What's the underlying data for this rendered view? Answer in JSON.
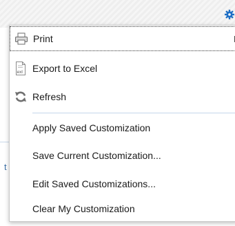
{
  "menu": {
    "items": [
      {
        "label": "Print",
        "icon": "printer-icon",
        "has_submenu": true
      },
      {
        "label": "Export to Excel",
        "icon": "excel-export-icon",
        "has_submenu": true
      },
      {
        "label": "Refresh",
        "icon": "refresh-icon",
        "has_submenu": false
      },
      {
        "label": "Apply Saved Customization",
        "has_submenu": true
      },
      {
        "label": "Save Current Customization...",
        "has_submenu": false
      },
      {
        "label": "Edit Saved Customizations...",
        "has_submenu": false
      },
      {
        "label": "Clear My Customization",
        "has_submenu": false
      }
    ]
  },
  "toolbar": {
    "settings_icon": "gear-icon"
  },
  "background": {
    "fragment_text": "t"
  },
  "colors": {
    "accent": "#1f6fc5",
    "separator": "#c4d7ea"
  }
}
